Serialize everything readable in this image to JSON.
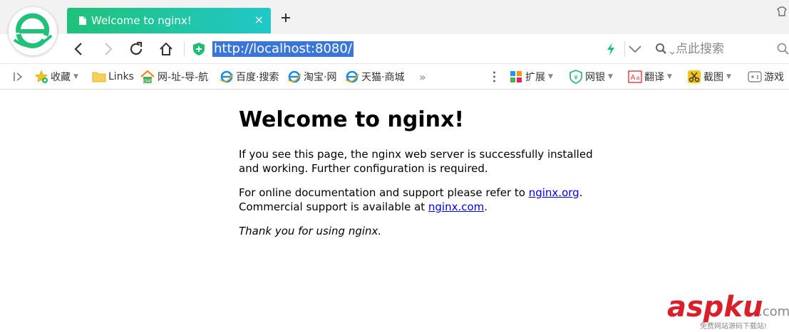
{
  "tab": {
    "title": "Welcome to nginx!",
    "close": "×"
  },
  "address": {
    "url": "http://localhost:8080/"
  },
  "search": {
    "placeholder": "点此搜索"
  },
  "bookmarks": {
    "items": [
      {
        "label": "收藏"
      },
      {
        "label": "Links"
      },
      {
        "label": "网-址-导-航"
      },
      {
        "label": "百度·搜索"
      },
      {
        "label": "淘宝·网"
      },
      {
        "label": "天猫·商城"
      }
    ],
    "overflow": "»",
    "tools": [
      {
        "label": "扩展"
      },
      {
        "label": "网银"
      },
      {
        "label": "翻译"
      },
      {
        "label": "截图"
      },
      {
        "label": "游戏"
      }
    ]
  },
  "page": {
    "heading": "Welcome to nginx!",
    "para1": "If you see this page, the nginx web server is successfully installed and working. Further configuration is required.",
    "para2_prefix": "For online documentation and support please refer to ",
    "link1": "nginx.org",
    "para2_mid": ".",
    "para2_line2": "Commercial support is available at ",
    "link2": "nginx.com",
    "para2_end": ".",
    "thanks": "Thank you for using nginx."
  },
  "watermark": {
    "logo": "aspku",
    "tld": ".com",
    "tagline": "免费网站源码下载站!"
  },
  "colors": {
    "tab_start": "#1fc27a",
    "tab_end": "#20c8c8",
    "url_highlight": "#3a76d6",
    "link": "#0000ee",
    "watermark": "#d9202a"
  }
}
